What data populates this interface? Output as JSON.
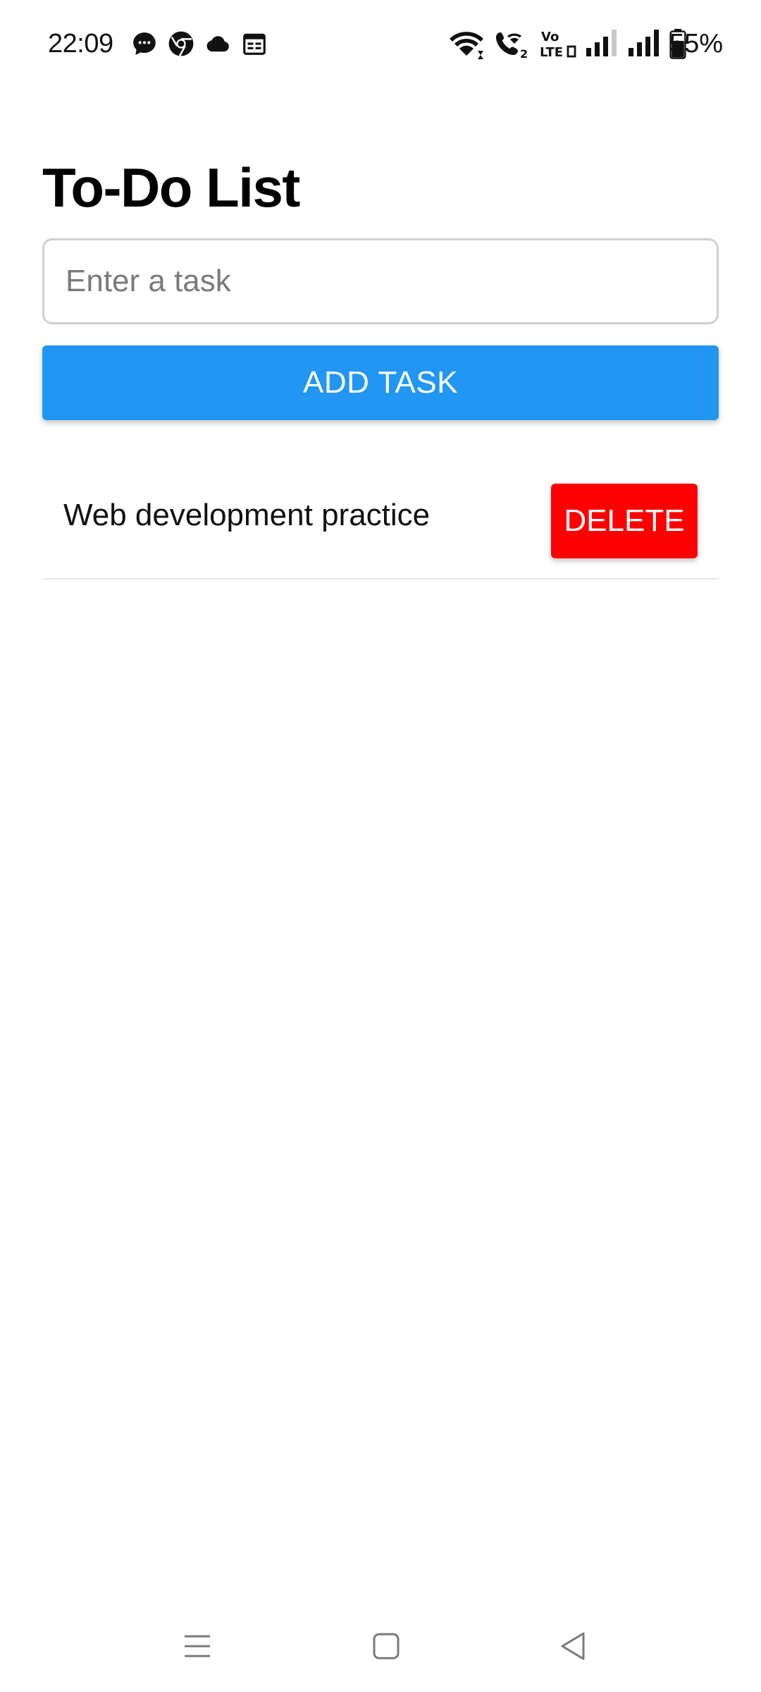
{
  "status_bar": {
    "time": "22:09",
    "battery_percent": "55%",
    "notification_icons": [
      "messages-icon",
      "chrome-icon",
      "cloud-icon",
      "calendar-icon"
    ],
    "system_icons": [
      "wifi-icon",
      "wifi-calling-icon",
      "volte-icon",
      "signal-sim1-icon",
      "signal-sim2-icon",
      "battery-icon"
    ],
    "volte_label": "Vo LTE"
  },
  "app": {
    "title": "To-Do List",
    "input": {
      "placeholder": "Enter a task",
      "value": ""
    },
    "add_button_label": "ADD TASK",
    "tasks": [
      {
        "text": "Web development practice",
        "delete_label": "DELETE"
      }
    ]
  },
  "colors": {
    "add_button": "#2196f3",
    "delete_button": "#ff0000",
    "background": "#ffffff"
  },
  "nav_bar": {
    "buttons": [
      "menu-icon",
      "home-icon",
      "back-icon"
    ]
  }
}
